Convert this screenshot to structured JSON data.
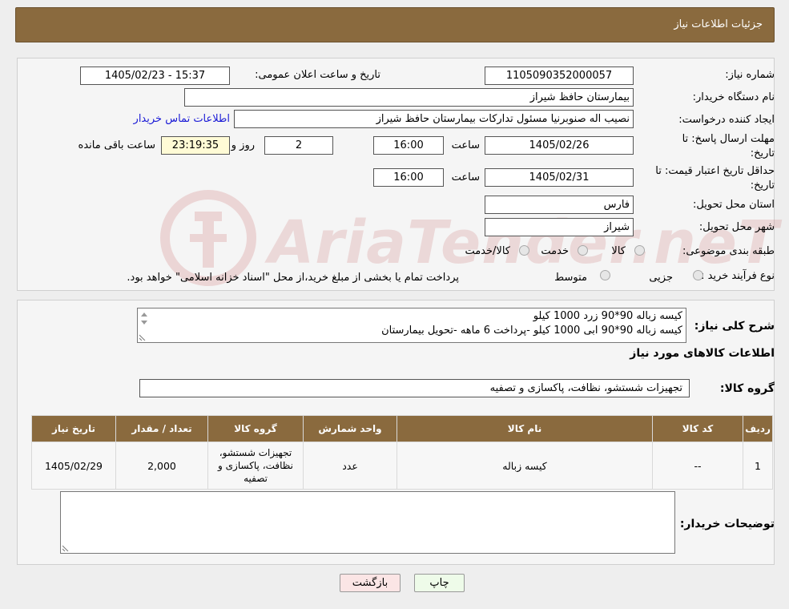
{
  "header": {
    "title": "جزئیات اطلاعات نیاز"
  },
  "form": {
    "need_number_label": "شماره نیاز:",
    "need_number": "1105090352000057",
    "announce_label": "تاریخ و ساعت اعلان عمومی:",
    "announce_value": "1405/02/23 - 15:37",
    "buyer_org_label": "نام دستگاه خریدار:",
    "buyer_org": "بیمارستان حافظ شیراز",
    "requester_label": "ایجاد کننده درخواست:",
    "requester": "نصیب اله صنوبرنیا مسئول تداركات بیمارستان حافظ شیراز",
    "contact_link": "اطلاعات تماس خریدار",
    "deadline_label_1": "مهلت ارسال پاسخ: تا",
    "deadline_label_2": "تاریخ:",
    "deadline_date": "1405/02/26",
    "time_label": "ساعت",
    "deadline_time": "16:00",
    "days_value": "2",
    "days_label": "روز و",
    "remaining_time": "23:19:35",
    "remaining_label": "ساعت باقی مانده",
    "validity_label_1": "حداقل تاریخ اعتبار قیمت: تا",
    "validity_label_2": "تاریخ:",
    "validity_date": "1405/02/31",
    "validity_time": "16:00",
    "province_label": "استان محل تحویل:",
    "province": "فارس",
    "city_label": "شهر محل تحویل:",
    "city": "شیراز",
    "category_label": "طبقه بندی موضوعی:",
    "category_options": [
      "کالا",
      "خدمت",
      "کالا/خدمت"
    ],
    "process_label": "نوع فرآیند خرید :",
    "process_options": [
      "جزیی",
      "متوسط"
    ],
    "process_note": "پرداخت تمام یا بخشی از مبلغ خرید،از محل \"اسناد خزانه اسلامی\" خواهد بود."
  },
  "description": {
    "label": "شرح کلی نیاز:",
    "lines": [
      "کیسه زباله 90*90 زرد 1000 کیلو",
      "کیسه زباله 90*90 ابی 1000 کیلو -پرداخت 6 ماهه -تحویل بیمارستان"
    ]
  },
  "goods_section": {
    "heading": "اطلاعات کالاهای مورد نیاز",
    "group_label": "گروه کالا:",
    "group_value": "تجهیزات شستشو، نظافت، پاکسازی و تصفیه"
  },
  "table": {
    "headers": [
      "ردیف",
      "کد کالا",
      "نام کالا",
      "واحد شمارش",
      "گروه کالا",
      "تعداد / مقدار",
      "تاریخ نیاز"
    ],
    "rows": [
      {
        "row": "1",
        "code": "--",
        "name": "کیسه زباله",
        "unit": "عدد",
        "group": "تجهیزات شستشو، نظافت، پاکسازی و تصفیه",
        "qty": "2,000",
        "date": "1405/02/29"
      }
    ]
  },
  "buyer_notes": {
    "label": "توضیحات خریدار:"
  },
  "buttons": {
    "print": "چاپ",
    "back": "بازگشت"
  },
  "watermark": {
    "text": "AriaTender.neT"
  },
  "colors": {
    "header_bg": "#8a6a3e",
    "link": "#1a1ad6"
  }
}
